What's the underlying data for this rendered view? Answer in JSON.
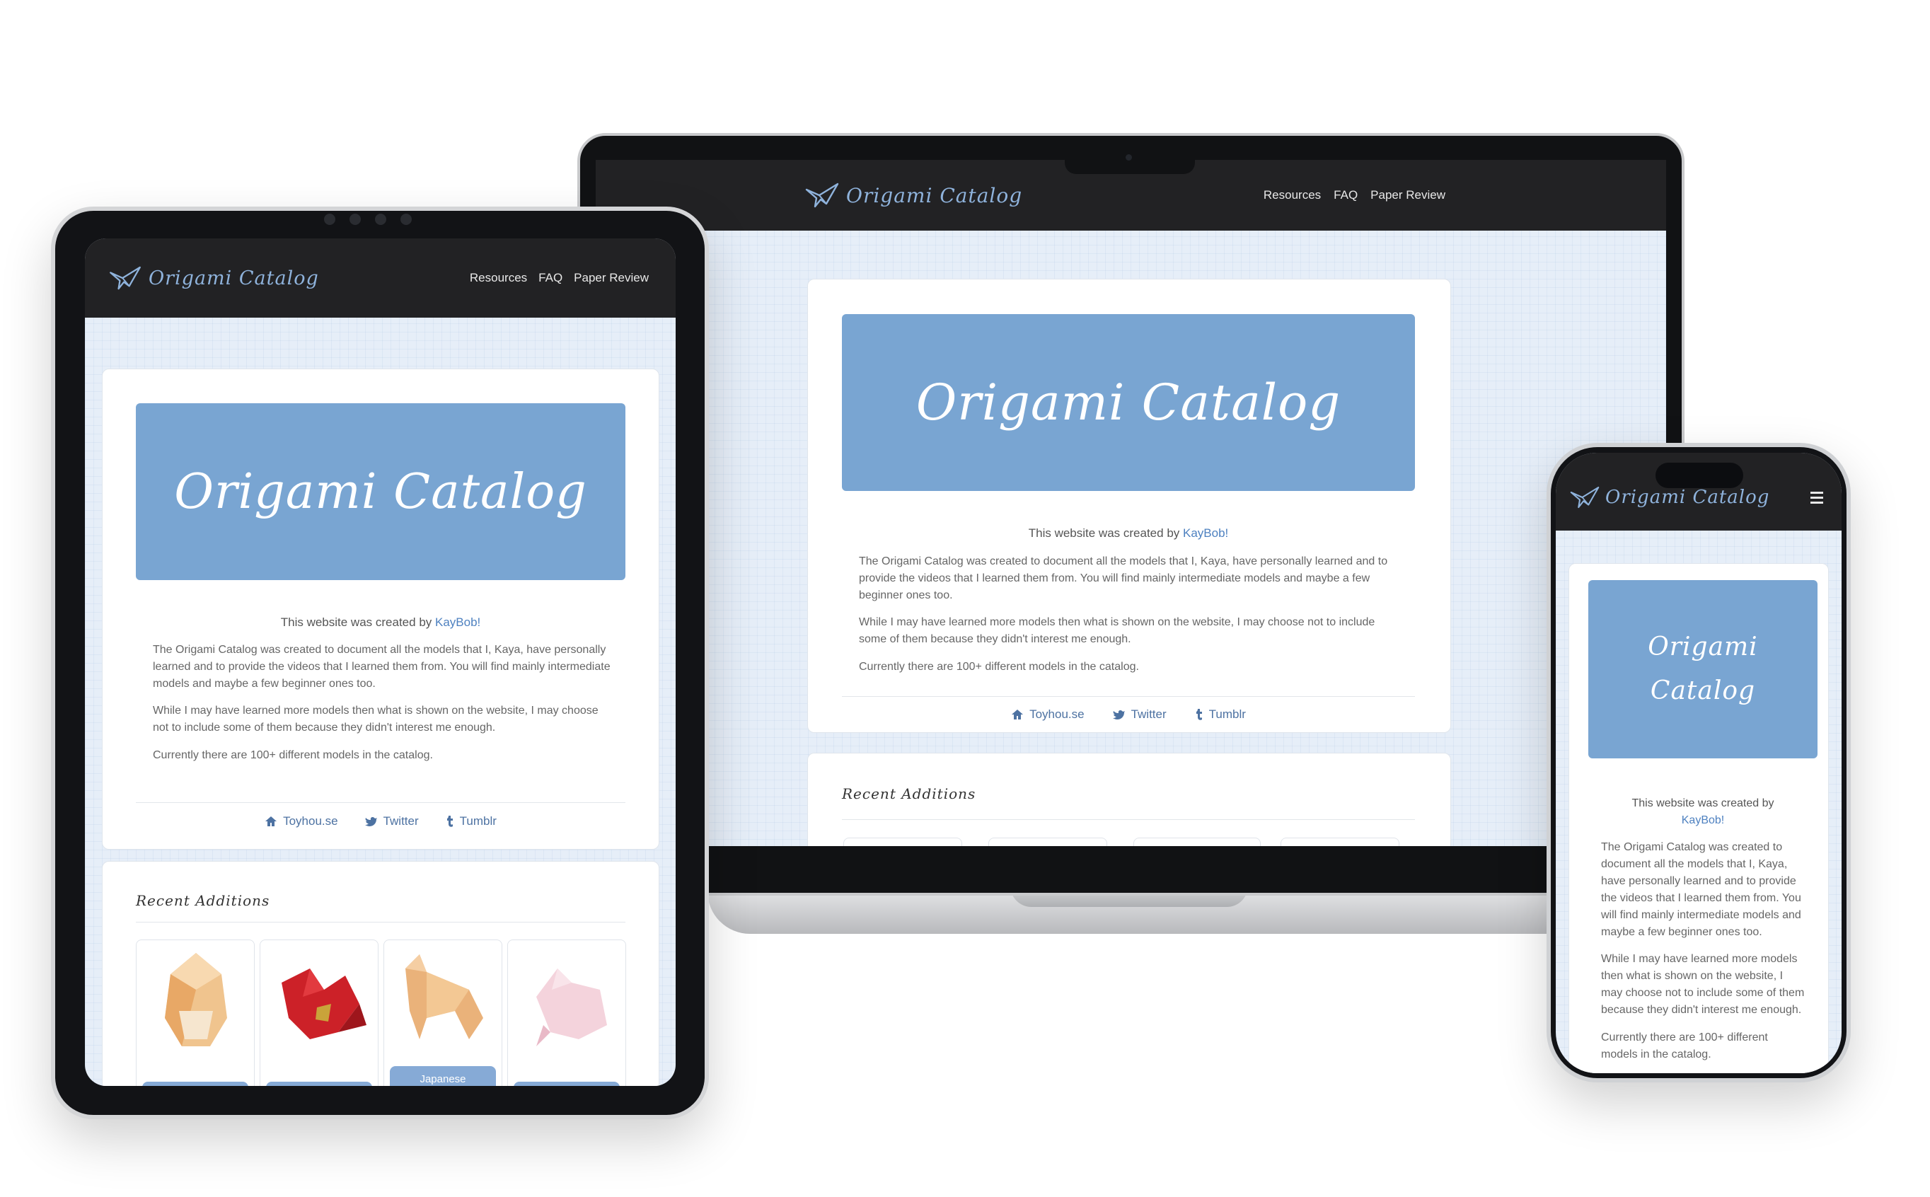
{
  "site": {
    "brand": "Origami Catalog",
    "nav": [
      "Resources",
      "FAQ",
      "Paper Review"
    ],
    "hero_title": "Origami Catalog",
    "credit_prefix": "This website was created by ",
    "credit_link": "KayBob!",
    "paragraphs": [
      "The Origami Catalog was created to document all the models that I, Kaya, have personally learned and to provide the videos that I learned them from. You will find mainly intermediate models and maybe a few beginner ones too.",
      "While I may have learned more models then what is shown on the website, I may choose not to include some of them because they didn't interest me enough.",
      "Currently there are 100+ different models in the catalog."
    ],
    "social": [
      "Toyhou.se",
      "Twitter",
      "Tumblr"
    ],
    "recent_title": "Recent Additions",
    "recent_caption": "Japanese",
    "menu_icon": "hamburger-icon"
  },
  "colors": {
    "navbar": "#222224",
    "brand": "#8fb3dc",
    "hero": "#79a5d2",
    "link": "#4e81c0",
    "page_bg": "#e6eef8"
  }
}
